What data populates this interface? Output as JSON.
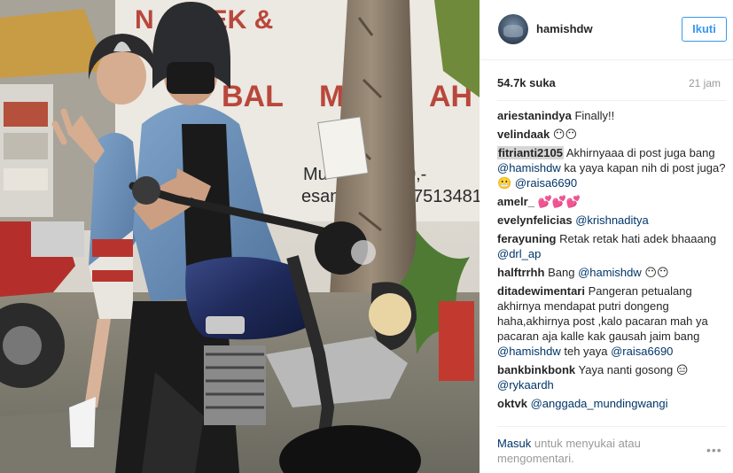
{
  "post": {
    "username": "hamishdw",
    "follow_label": "Ikuti",
    "likes": "54.7k suka",
    "date": "21 jam",
    "photo_text": {
      "top_sign": "BEK &",
      "mid_sign": "BAL",
      "price_fragment": "0,-",
      "phone_fragment": "7513481",
      "word_fragment": "Mu",
      "word_fragment2": "esan",
      "left_sign": "N",
      "left_sign2": "M",
      "right_sign": "AH"
    }
  },
  "comments": [
    {
      "user": "ariestanindya",
      "parts": [
        {
          "t": "text",
          "v": "Finally!!"
        }
      ]
    },
    {
      "user": "velindaak",
      "parts": [
        {
          "t": "text",
          "v": "😶😶"
        }
      ]
    },
    {
      "user": "fitrianti2105",
      "highlight": true,
      "parts": [
        {
          "t": "text",
          "v": "Akhirnyaaa di post juga bang "
        },
        {
          "t": "mention",
          "v": "@hamishdw"
        },
        {
          "t": "text",
          "v": " ka yaya kapan nih di post juga? 😬 "
        },
        {
          "t": "mention",
          "v": "@raisa6690"
        }
      ]
    },
    {
      "user": "amelr_",
      "parts": [
        {
          "t": "text",
          "v": "💕💕💕"
        }
      ]
    },
    {
      "user": "evelynfelicias",
      "parts": [
        {
          "t": "mention",
          "v": "@krishnaditya"
        }
      ]
    },
    {
      "user": "ferayuning",
      "parts": [
        {
          "t": "text",
          "v": "Retak retak hati adek bhaaang "
        },
        {
          "t": "mention",
          "v": "@drl_ap"
        }
      ]
    },
    {
      "user": "halftrrhh",
      "parts": [
        {
          "t": "text",
          "v": "Bang "
        },
        {
          "t": "mention",
          "v": "@hamishdw"
        },
        {
          "t": "text",
          "v": " 😶😶"
        }
      ]
    },
    {
      "user": "ditadewimentari",
      "parts": [
        {
          "t": "text",
          "v": "Pangeran petualang akhirnya mendapat putri dongeng haha,akhirnya post ,kalo pacaran mah ya pacaran aja kalle kak gausah jaim bang "
        },
        {
          "t": "mention",
          "v": "@hamishdw"
        },
        {
          "t": "text",
          "v": " teh yaya "
        },
        {
          "t": "mention",
          "v": "@raisa6690"
        }
      ]
    },
    {
      "user": "bankbinkbonk",
      "parts": [
        {
          "t": "text",
          "v": "Yaya nanti gosong 😑 "
        },
        {
          "t": "mention",
          "v": "@rykaardh"
        }
      ]
    },
    {
      "user": "oktvk",
      "parts": [
        {
          "t": "mention",
          "v": "@anggada_mundingwangi"
        }
      ]
    }
  ],
  "footer": {
    "login_label": "Masuk",
    "login_suffix": " untuk menyukai atau mengomentari.",
    "more_label": "•••"
  },
  "colors": {
    "accent": "#3897f0",
    "mention": "#003569",
    "muted": "#999999"
  },
  "icons": {
    "more": "more-options-icon",
    "avatar": "profile-avatar"
  }
}
